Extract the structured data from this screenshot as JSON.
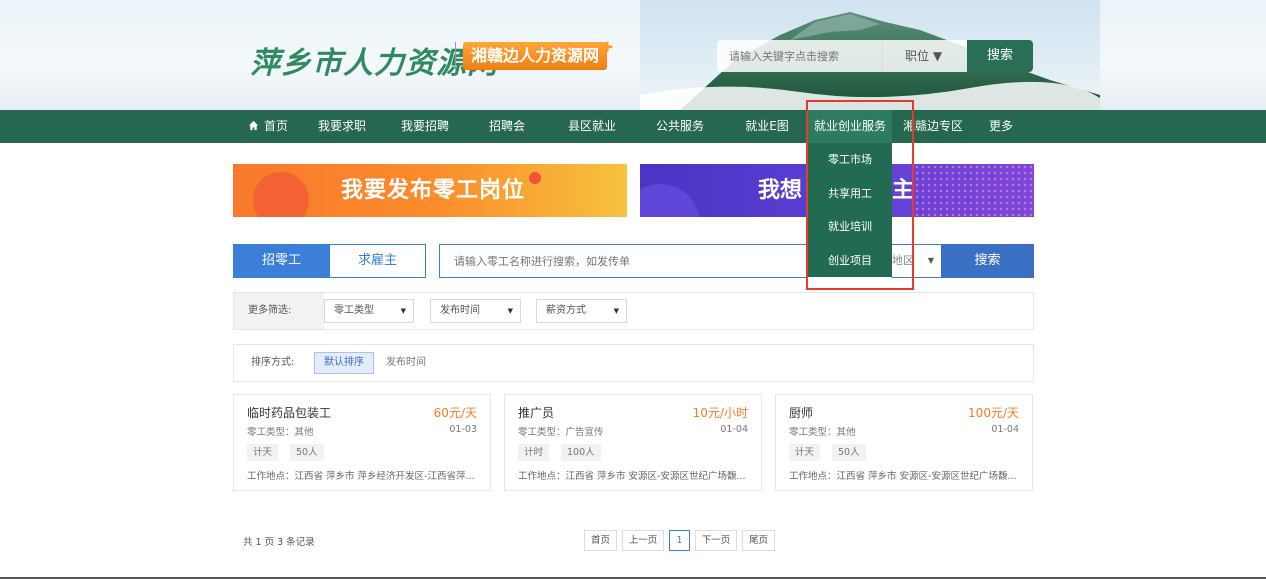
{
  "header": {
    "logo_text": "萍乡市人力资源网",
    "logo2_text": "湘赣边人力资源网",
    "search": {
      "placeholder": "请输入关键字点击搜索",
      "type_label": "职位 ▼",
      "button_label": "搜索"
    }
  },
  "nav": {
    "items": [
      {
        "label": "首页",
        "icon": "home-icon"
      },
      {
        "label": "我要求职"
      },
      {
        "label": "我要招聘"
      },
      {
        "label": "招聘会"
      },
      {
        "label": "县区就业"
      },
      {
        "label": "公共服务"
      },
      {
        "label": "就业E图"
      },
      {
        "label": "就业创业服务"
      },
      {
        "label": "湘赣边专区"
      },
      {
        "label": "更多"
      }
    ],
    "dropdown": [
      "零工市场",
      "共享用工",
      "就业培训",
      "创业项目"
    ]
  },
  "banners": {
    "left": "我要发布零工岗位",
    "right_a": "我想",
    "right_b": "主"
  },
  "tabs": [
    "招零工",
    "求雇主"
  ],
  "odd_search": {
    "placeholder": "请输入零工名称进行搜索，如发传单",
    "region_label": "地区",
    "button_label": "搜索"
  },
  "filters": {
    "label": "更多筛选:",
    "selects": [
      "零工类型",
      "发布时间",
      "薪资方式"
    ]
  },
  "sort": {
    "label": "排序方式:",
    "default_label": "默认排序",
    "time_label": "发布时间"
  },
  "jobs": [
    {
      "title": "临时药品包装工",
      "salary": "60元/天",
      "type": "零工类型：其他",
      "date": "01-03",
      "tags": [
        "计天",
        "50人"
      ],
      "address": "工作地点：江西省 萍乡市 萍乡经济开发区-江西省萍..."
    },
    {
      "title": "推广员",
      "salary": "10元/小时",
      "type": "零工类型：广告宣传",
      "date": "01-04",
      "tags": [
        "计时",
        "100人"
      ],
      "address": "工作地点：江西省 萍乡市 安源区-安源区世纪广场馥..."
    },
    {
      "title": "厨师",
      "salary": "100元/天",
      "type": "零工类型：其他",
      "date": "01-04",
      "tags": [
        "计天",
        "50人"
      ],
      "address": "工作地点：江西省 萍乡市 安源区-安源区世纪广场馥..."
    }
  ],
  "pagination": {
    "records": "共 1 页 3 条记录",
    "first": "首页",
    "prev": "上一页",
    "current": "1",
    "next": "下一页",
    "last": "尾页"
  },
  "colors": {
    "nav_bg": "#26674f",
    "accent_blue": "#3b7fd8",
    "salary_orange": "#f57c22",
    "highlight_red": "#e43b2a"
  }
}
